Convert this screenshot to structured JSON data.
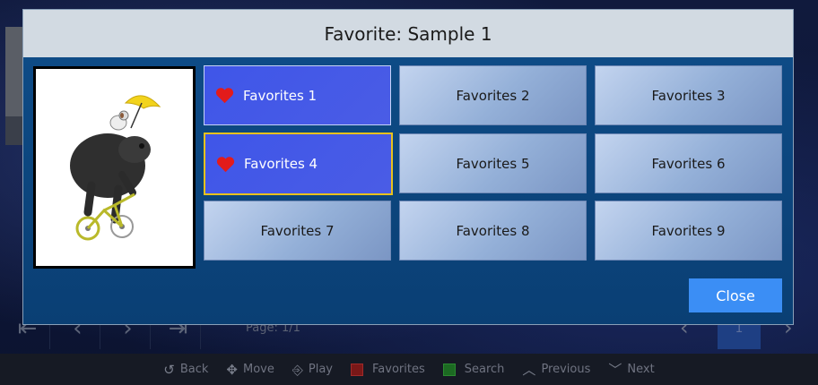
{
  "dialog": {
    "title": "Favorite: Sample 1",
    "close_label": "Close",
    "tiles": [
      {
        "label": "Favorites 1",
        "favorite": true
      },
      {
        "label": "Favorites 2",
        "favorite": false
      },
      {
        "label": "Favorites 3",
        "favorite": false
      },
      {
        "label": "Favorites 4",
        "favorite": true
      },
      {
        "label": "Favorites 5",
        "favorite": false
      },
      {
        "label": "Favorites 6",
        "favorite": false
      },
      {
        "label": "Favorites 7",
        "favorite": false
      },
      {
        "label": "Favorites 8",
        "favorite": false
      },
      {
        "label": "Favorites 9",
        "favorite": false
      }
    ]
  },
  "background": {
    "page_label": "Page: 1/1",
    "page_number": "1"
  },
  "hints": {
    "back": "Back",
    "move": "Move",
    "play": "Play",
    "favorites": "Favorites",
    "search": "Search",
    "previous": "Previous",
    "next": "Next"
  },
  "colors": {
    "dialog_bg": "#0d4780",
    "favorite_tile": "#4050e6",
    "focus_border": "#e8c21c",
    "close_button": "#3b8ef5",
    "heart": "#e31b1b"
  }
}
